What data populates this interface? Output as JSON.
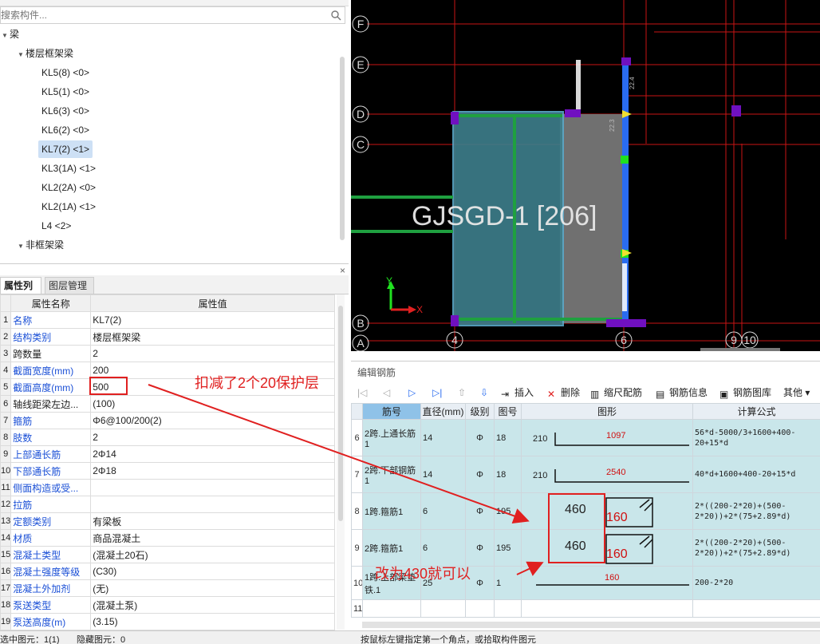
{
  "search": {
    "placeholder": "搜索构件..."
  },
  "tree": {
    "root": "梁",
    "group1": "楼层框架梁",
    "items": [
      "KL5(8) <0>",
      "KL5(1) <0>",
      "KL6(3) <0>",
      "KL6(2) <0>",
      "KL7(2) <1>",
      "KL3(1A) <1>",
      "KL2(2A) <0>",
      "KL2(1A) <1>",
      "L4 <2>"
    ],
    "group2": "非框架梁"
  },
  "prop": {
    "close": "×",
    "tab_props": "属性列表",
    "tab_layers": "图层管理",
    "col_name": "属性名称",
    "col_value": "属性值",
    "rows": [
      {
        "n": "1",
        "name": "名称",
        "value": "KL7(2)"
      },
      {
        "n": "2",
        "name": "结构类别",
        "value": "楼层框架梁"
      },
      {
        "n": "3",
        "name": "跨数量",
        "value": "2"
      },
      {
        "n": "4",
        "name": "截面宽度(mm)",
        "value": "200"
      },
      {
        "n": "5",
        "name": "截面高度(mm)",
        "value": "500"
      },
      {
        "n": "6",
        "name": "轴线距梁左边...",
        "value": "(100)"
      },
      {
        "n": "7",
        "name": "箍筋",
        "value": "Φ6@100/200(2)"
      },
      {
        "n": "8",
        "name": "肢数",
        "value": "2"
      },
      {
        "n": "9",
        "name": "上部通长筋",
        "value": "2Φ14"
      },
      {
        "n": "10",
        "name": "下部通长筋",
        "value": "2Φ18"
      },
      {
        "n": "11",
        "name": "侧面构造或受...",
        "value": ""
      },
      {
        "n": "12",
        "name": "拉筋",
        "value": ""
      },
      {
        "n": "13",
        "name": "定额类别",
        "value": "有梁板"
      },
      {
        "n": "14",
        "name": "材质",
        "value": "商品混凝土"
      },
      {
        "n": "15",
        "name": "混凝土类型",
        "value": "(混凝土20石)"
      },
      {
        "n": "16",
        "name": "混凝土强度等级",
        "value": "(C30)"
      },
      {
        "n": "17",
        "name": "混凝土外加剂",
        "value": "(无)"
      },
      {
        "n": "18",
        "name": "泵送类型",
        "value": "(混凝土泵)"
      },
      {
        "n": "19",
        "name": "泵送高度(m)",
        "value": "(3.15)"
      }
    ]
  },
  "status": {
    "selected": "选中图元：1(1)",
    "hidden": "隐藏图元：0",
    "hint": "按鼠标左键指定第一个角点，或拾取构件图元"
  },
  "cad": {
    "axes_left": [
      "F",
      "E",
      "D",
      "C",
      "B",
      "A"
    ],
    "axes_bottom": [
      "4",
      "6",
      "9",
      "10"
    ],
    "label": "GJSGD-1 [206]",
    "axis_x": "X",
    "axis_y": "Y",
    "dims": [
      "22.4",
      "22.3"
    ]
  },
  "rebar": {
    "title": "编辑钢筋",
    "toolbar": {
      "insert": "插入",
      "delete": "删除",
      "scale": "缩尺配筋",
      "info": "钢筋信息",
      "library": "钢筋图库",
      "other": "其他"
    },
    "headers": [
      "",
      "筋号",
      "直径(mm)",
      "级别",
      "图号",
      "图形",
      "计算公式"
    ],
    "rows": [
      {
        "n": "6",
        "name": "2跨.上通长筋1",
        "dia": "14",
        "grade": "Φ",
        "fig": "18",
        "s1": "210",
        "s2": "1097",
        "formula": "56*d-5000/3+1600+400-20+15*d"
      },
      {
        "n": "7",
        "name": "2跨.下部钢筋1",
        "dia": "14",
        "grade": "Φ",
        "fig": "18",
        "s1": "210",
        "s2": "2540",
        "formula": "40*d+1600+400-20+15*d"
      },
      {
        "n": "8",
        "name": "1跨.箍筋1",
        "dia": "6",
        "grade": "Φ",
        "fig": "195",
        "s1": "460",
        "s2": "160",
        "formula": "2*((200-2*20)+(500-2*20))+2*(75+2.89*d)"
      },
      {
        "n": "9",
        "name": "2跨.箍筋1",
        "dia": "6",
        "grade": "Φ",
        "fig": "195",
        "s1": "460",
        "s2": "160",
        "formula": "2*((200-2*20)+(500-2*20))+2*(75+2.89*d)"
      },
      {
        "n": "10",
        "name": "1跨.上部梁垫铁.1",
        "dia": "25",
        "grade": "Φ",
        "fig": "1",
        "s1": "",
        "s2": "160",
        "formula": "200-2*20"
      },
      {
        "n": "11",
        "name": "",
        "dia": "",
        "grade": "",
        "fig": "",
        "s1": "",
        "s2": "",
        "formula": ""
      }
    ]
  },
  "annotations": {
    "note1": "扣减了2个20保护层",
    "note2": "改为430就可以"
  },
  "colors": {
    "accent_red": "#e02020",
    "cad_red": "#d01010",
    "grid_green": "#1fa040",
    "beam_teal": "#3d7f8c"
  }
}
